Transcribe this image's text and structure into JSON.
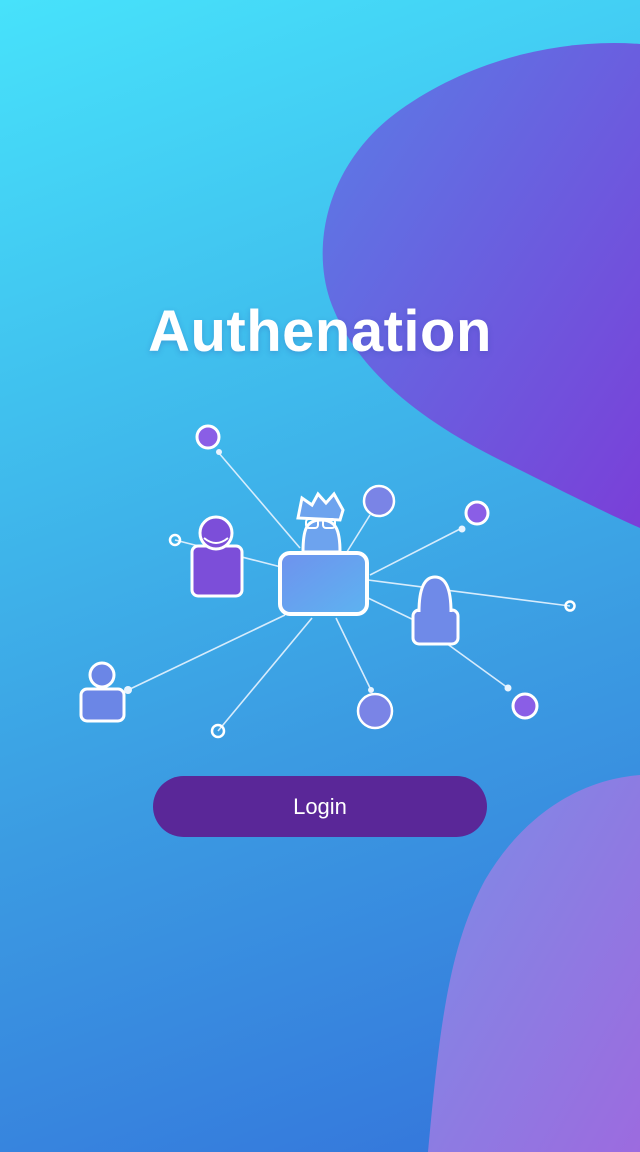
{
  "app": {
    "title": "Authenation"
  },
  "actions": {
    "login_label": "Login"
  },
  "illustration": {
    "name": "user-network-illustration",
    "icons": [
      "person-icon",
      "network-node"
    ]
  },
  "theme": {
    "gradient_start": "#47e2fb",
    "gradient_end": "#3473db",
    "blob_purple": "#7a3fd8",
    "button_color": "#5a2798",
    "text_color": "#ffffff"
  }
}
